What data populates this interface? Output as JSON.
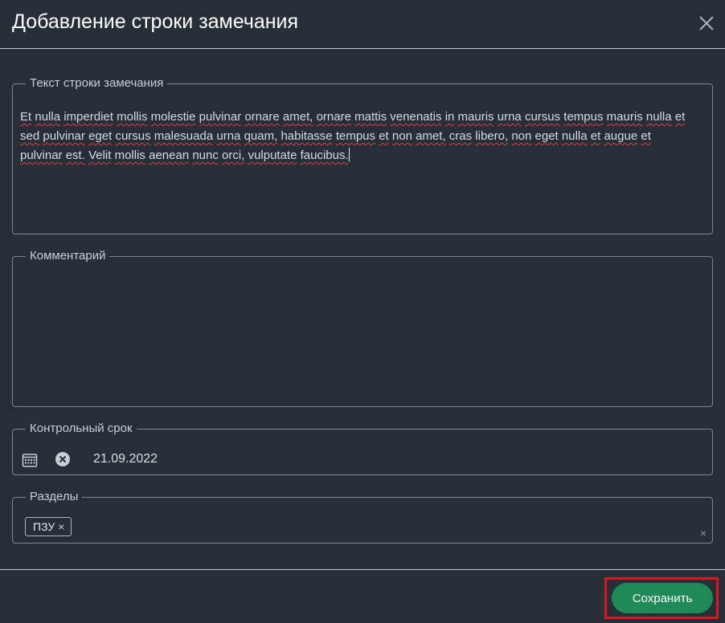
{
  "dialog": {
    "title": "Добавление строки замечания",
    "close_icon": "close-icon"
  },
  "remark_text": {
    "label": "Текст строки замечания",
    "value": "Et nulla imperdiet mollis molestie pulvinar ornare amet, ornare mattis venenatis in mauris urna cursus tempus mauris nulla et sed pulvinar eget cursus malesuada urna quam, habitasse tempus et non amet, cras libero, non eget nulla et augue et pulvinar est. Velit mollis aenean nunc orci, vulputate faucibus."
  },
  "comment": {
    "label": "Комментарий",
    "value": ""
  },
  "deadline": {
    "label": "Контрольный срок",
    "value": "21.09.2022",
    "calendar_icon": "calendar-icon",
    "clear_icon": "clear-circle-icon"
  },
  "sections": {
    "label": "Разделы",
    "tags": [
      "ПЗУ"
    ],
    "tag_remove_glyph": "×",
    "clear_all_glyph": "×"
  },
  "footer": {
    "save_label": "Сохранить"
  },
  "colors": {
    "background": "#262f38",
    "accent_button": "#1f8a58",
    "highlight_border": "#e5131d"
  }
}
